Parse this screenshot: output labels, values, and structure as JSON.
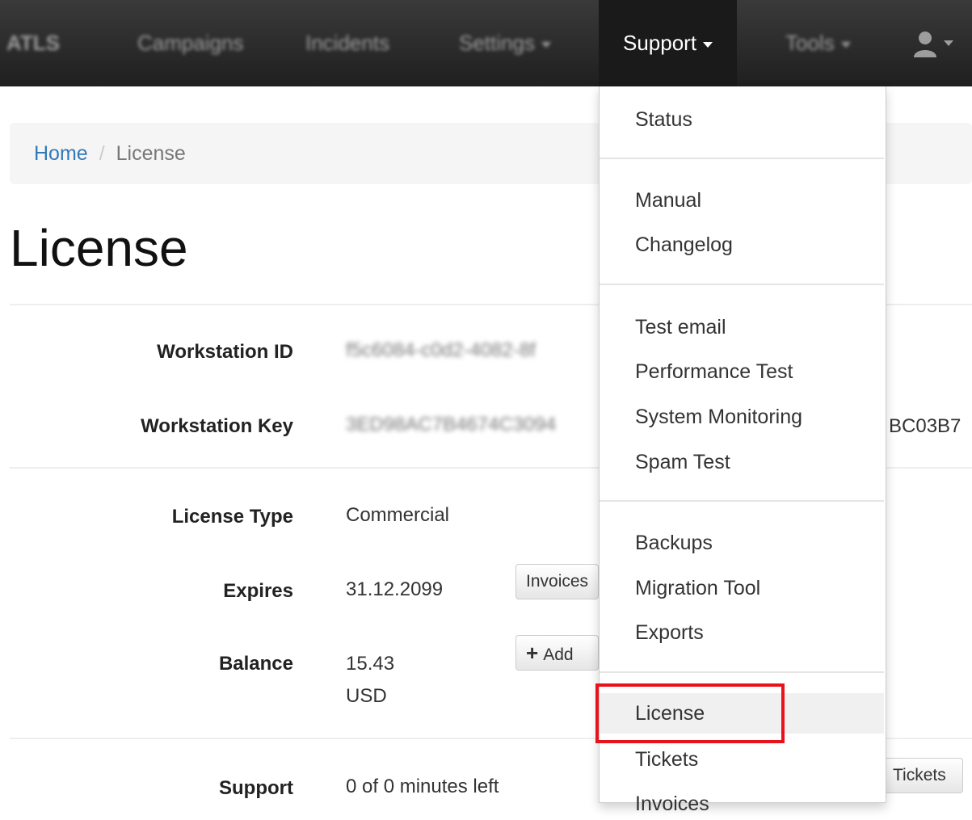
{
  "navbar": {
    "brand": "ATLS",
    "items": [
      {
        "label": "Campaigns"
      },
      {
        "label": "Incidents"
      },
      {
        "label": "Settings"
      },
      {
        "label": "Support"
      },
      {
        "label": "Tools"
      }
    ],
    "user_icon": "user-icon"
  },
  "breadcrumb": {
    "home": "Home",
    "separator": "/",
    "current": "License"
  },
  "page_title": "License",
  "workstation": {
    "id_label": "Workstation ID",
    "id_value": "f5c6084-c0d2-4082-8f",
    "key_label": "Workstation Key",
    "key_value": "3ED98AC7B4674C3094",
    "key_suffix": "BC03B7"
  },
  "license": {
    "type_label": "License Type",
    "type_value": "Commercial",
    "expires_label": "Expires",
    "expires_value": "31.12.2099",
    "invoices_button": "Invoices",
    "balance_label": "Balance",
    "balance_amount": "15.43",
    "balance_currency": "USD",
    "add_button": "Add"
  },
  "support": {
    "label": "Support",
    "value": "0 of 0 minutes left",
    "tickets_button": "Tickets"
  },
  "support_menu": {
    "groups": [
      [
        "Status"
      ],
      [
        "Manual",
        "Changelog"
      ],
      [
        "Test email",
        "Performance Test",
        "System Monitoring",
        "Spam Test"
      ],
      [
        "Backups",
        "Migration Tool",
        "Exports"
      ],
      [
        "License",
        "Tickets",
        "Invoices"
      ]
    ],
    "active_item": "License",
    "highlight_color": "#e8121b"
  }
}
